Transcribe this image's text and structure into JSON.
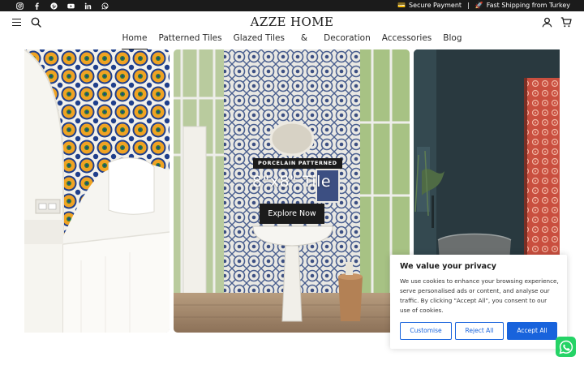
{
  "topbar": {
    "social_icons": [
      "instagram-icon",
      "facebook-icon",
      "pinterest-icon",
      "youtube-icon",
      "linkedin-icon",
      "whatsapp-icon"
    ],
    "secure_payment": "Secure Payment",
    "separator": "|",
    "shipping": "Fast Shipping from Turkey"
  },
  "header": {
    "logo": "AZZE HOME",
    "nav": [
      "Home",
      "Patterned Tiles",
      "Glazed Tiles",
      "&",
      "Decoration",
      "Accessories",
      "Blog"
    ],
    "active_nav": "Home"
  },
  "hero": {
    "badge": "PORCELAIN PATTERNED",
    "title": "8\"x8\" Tile",
    "button": "Explore Now"
  },
  "cookie": {
    "title": "We value your privacy",
    "text": "We use cookies to enhance your browsing experience, serve personalised ads or content, and analyse our traffic. By clicking \"Accept All\", you consent to our use of cookies.",
    "customise": "Customise",
    "reject": "Reject All",
    "accept": "Accept All",
    "accent": "#1863dc"
  },
  "colors": {
    "topbar": "#1b1b1b",
    "whatsapp": "#25d366"
  }
}
